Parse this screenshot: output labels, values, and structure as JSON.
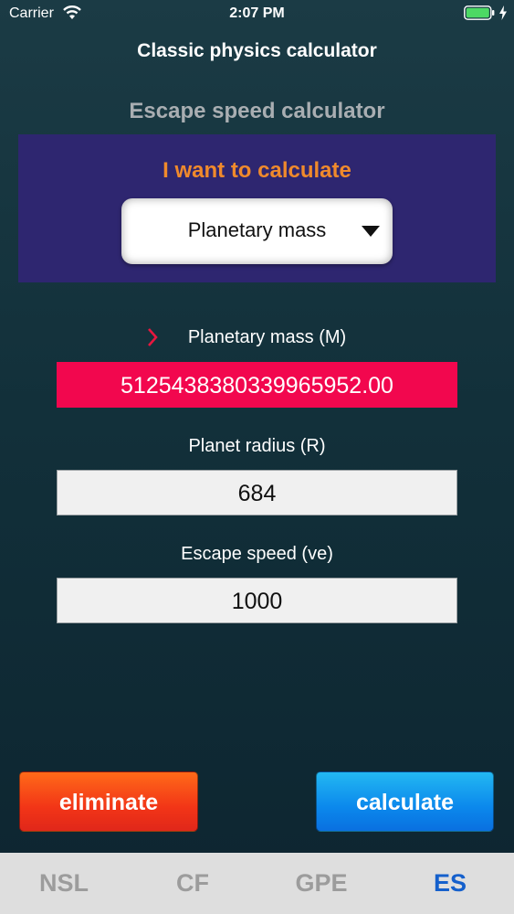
{
  "status_bar": {
    "carrier": "Carrier",
    "time": "2:07 PM"
  },
  "app": {
    "title": "Classic physics calculator"
  },
  "calculator": {
    "title": "Escape speed calculator",
    "prompt": "I want to calculate",
    "selected_target": "Planetary mass"
  },
  "fields": [
    {
      "label": "Planetary mass (M)",
      "value": "5125438380339965952.00",
      "active": true
    },
    {
      "label": "Planet radius (R)",
      "value": "684",
      "active": false
    },
    {
      "label": "Escape speed (ve)",
      "value": "1000",
      "active": false
    }
  ],
  "buttons": {
    "eliminate": "eliminate",
    "calculate": "calculate"
  },
  "tabs": [
    {
      "label": "NSL",
      "active": false
    },
    {
      "label": "CF",
      "active": false
    },
    {
      "label": "GPE",
      "active": false
    },
    {
      "label": "ES",
      "active": true
    }
  ],
  "colors": {
    "panel": "#2e2670",
    "prompt": "#f08a2c",
    "active_field": "#f2074e",
    "eliminate": "#f23517",
    "calculate": "#0b88ec",
    "active_tab": "#1560cc"
  }
}
